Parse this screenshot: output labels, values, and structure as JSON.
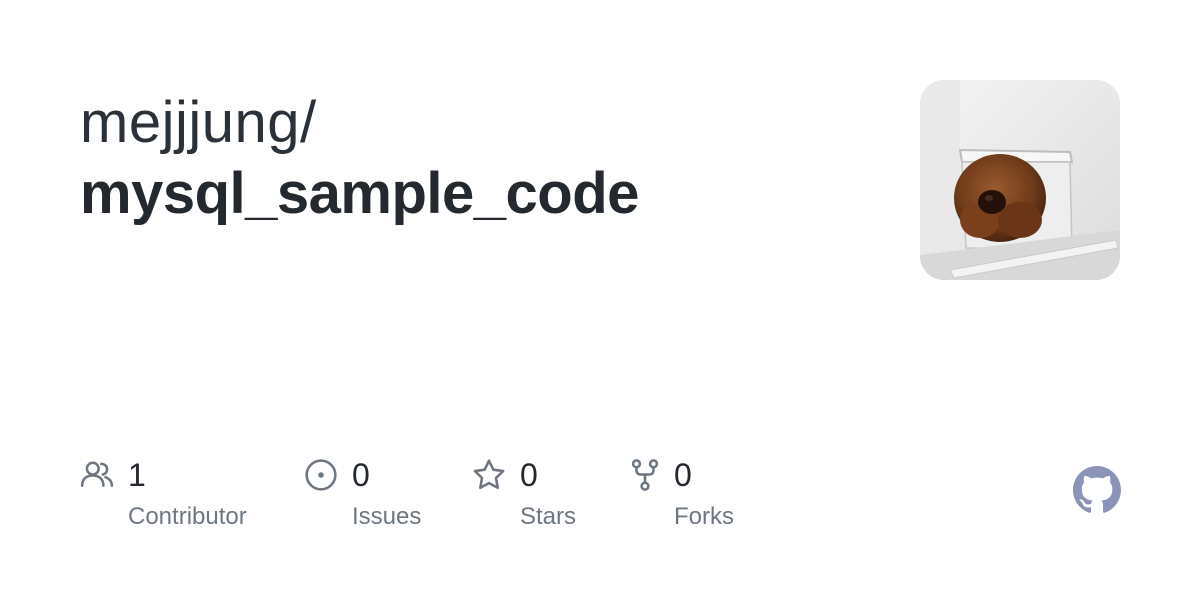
{
  "repo_card": {
    "owner": "mejjjung/",
    "name": "mysql_sample_code"
  },
  "stats": [
    {
      "icon": "people-icon",
      "value": "1",
      "label": "Contributor"
    },
    {
      "icon": "issue-icon",
      "value": "0",
      "label": "Issues"
    },
    {
      "icon": "star-icon",
      "value": "0",
      "label": "Stars"
    },
    {
      "icon": "fork-icon",
      "value": "0",
      "label": "Forks"
    }
  ],
  "colors": {
    "icon": "#6e7781",
    "logo": "#8b93b8"
  }
}
